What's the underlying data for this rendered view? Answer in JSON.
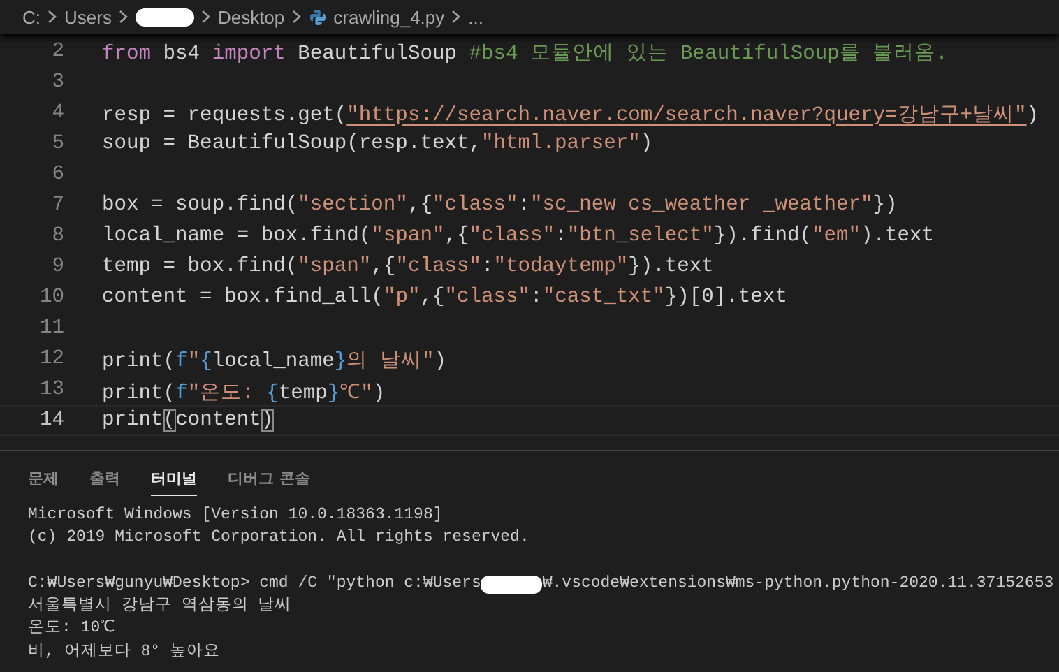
{
  "breadcrumb": [
    {
      "kind": "text",
      "text": "C:"
    },
    {
      "kind": "text",
      "text": "Users"
    },
    {
      "kind": "redacted"
    },
    {
      "kind": "text",
      "text": "Desktop"
    },
    {
      "kind": "file",
      "text": "crawling_4.py"
    },
    {
      "kind": "text",
      "text": "..."
    }
  ],
  "editor": {
    "lines": [
      {
        "number": "2",
        "current": false,
        "tokens": [
          {
            "kind": "keyword",
            "text": "from"
          },
          {
            "kind": "plain",
            "text": " bs4 "
          },
          {
            "kind": "keyword",
            "text": "import"
          },
          {
            "kind": "plain",
            "text": " BeautifulSoup "
          },
          {
            "kind": "comment",
            "text": "#bs4 모듈안에 있는 BeautifulSoup를 불러옴."
          }
        ]
      },
      {
        "number": "3",
        "current": false
      },
      {
        "number": "4",
        "current": false,
        "tokens": [
          {
            "kind": "plain",
            "text": "resp = requests.get("
          },
          {
            "kind": "link",
            "text": "\"https://search.naver.com/search.naver?query=강남구+날씨\""
          },
          {
            "kind": "plain",
            "text": ")"
          }
        ]
      },
      {
        "number": "5",
        "current": false,
        "tokens": [
          {
            "kind": "plain",
            "text": "soup = BeautifulSoup(resp.text,"
          },
          {
            "kind": "string",
            "text": "\"html.parser\""
          },
          {
            "kind": "plain",
            "text": ")"
          }
        ]
      },
      {
        "number": "6",
        "current": false
      },
      {
        "number": "7",
        "current": false,
        "tokens": [
          {
            "kind": "plain",
            "text": "box = soup.find("
          },
          {
            "kind": "string",
            "text": "\"section\""
          },
          {
            "kind": "plain",
            "text": ",{"
          },
          {
            "kind": "string",
            "text": "\"class\""
          },
          {
            "kind": "plain",
            "text": ":"
          },
          {
            "kind": "string",
            "text": "\"sc_new cs_weather _weather\""
          },
          {
            "kind": "plain",
            "text": "})"
          }
        ]
      },
      {
        "number": "8",
        "current": false,
        "tokens": [
          {
            "kind": "plain",
            "text": "local_name = box.find("
          },
          {
            "kind": "string",
            "text": "\"span\""
          },
          {
            "kind": "plain",
            "text": ",{"
          },
          {
            "kind": "string",
            "text": "\"class\""
          },
          {
            "kind": "plain",
            "text": ":"
          },
          {
            "kind": "string",
            "text": "\"btn_select\""
          },
          {
            "kind": "plain",
            "text": "}).find("
          },
          {
            "kind": "string",
            "text": "\"em\""
          },
          {
            "kind": "plain",
            "text": ").text"
          }
        ]
      },
      {
        "number": "9",
        "current": false,
        "tokens": [
          {
            "kind": "plain",
            "text": "temp = box.find("
          },
          {
            "kind": "string",
            "text": "\"span\""
          },
          {
            "kind": "plain",
            "text": ",{"
          },
          {
            "kind": "string",
            "text": "\"class\""
          },
          {
            "kind": "plain",
            "text": ":"
          },
          {
            "kind": "string",
            "text": "\"todaytemp\""
          },
          {
            "kind": "plain",
            "text": "}).text"
          }
        ]
      },
      {
        "number": "10",
        "current": false,
        "tokens": [
          {
            "kind": "plain",
            "text": "content = box.find_all("
          },
          {
            "kind": "string",
            "text": "\"p\""
          },
          {
            "kind": "plain",
            "text": ",{"
          },
          {
            "kind": "string",
            "text": "\"class\""
          },
          {
            "kind": "plain",
            "text": ":"
          },
          {
            "kind": "string",
            "text": "\"cast_txt\""
          },
          {
            "kind": "plain",
            "text": "})[0].text"
          }
        ]
      },
      {
        "number": "11",
        "current": false
      },
      {
        "number": "12",
        "current": false,
        "tokens": [
          {
            "kind": "plain",
            "text": "print("
          },
          {
            "kind": "fprefix",
            "text": "f"
          },
          {
            "kind": "string",
            "text": "\""
          },
          {
            "kind": "brace",
            "text": "{"
          },
          {
            "kind": "plain",
            "text": "local_name"
          },
          {
            "kind": "brace",
            "text": "}"
          },
          {
            "kind": "string",
            "text": "의 날씨\""
          },
          {
            "kind": "plain",
            "text": ")"
          }
        ]
      },
      {
        "number": "13",
        "current": false,
        "tokens": [
          {
            "kind": "plain",
            "text": "print("
          },
          {
            "kind": "fprefix",
            "text": "f"
          },
          {
            "kind": "string",
            "text": "\"온도: "
          },
          {
            "kind": "brace",
            "text": "{"
          },
          {
            "kind": "plain",
            "text": "temp"
          },
          {
            "kind": "brace",
            "text": "}"
          },
          {
            "kind": "string",
            "text": "℃\""
          },
          {
            "kind": "plain",
            "text": ")"
          }
        ]
      },
      {
        "number": "14",
        "current": true,
        "tokens": [
          {
            "kind": "plain",
            "text": "print"
          },
          {
            "kind": "bracket_match",
            "text": "("
          },
          {
            "kind": "plain",
            "text": "content"
          },
          {
            "kind": "bracket_match",
            "text": ")"
          }
        ]
      }
    ]
  },
  "panel": {
    "tabs": [
      {
        "label": "문제",
        "selected": false
      },
      {
        "label": "출력",
        "selected": false
      },
      {
        "label": "터미널",
        "selected": true
      },
      {
        "label": "디버그 콘솔",
        "selected": false
      }
    ],
    "terminal": [
      {
        "kind": "text",
        "text": "Microsoft Windows [Version 10.0.18363.1198]"
      },
      {
        "kind": "text",
        "text": "(c) 2019 Microsoft Corporation. All rights reserved."
      },
      {
        "kind": "blank"
      },
      {
        "kind": "redacted",
        "before": "C:₩Users₩gunyu₩Desktop> cmd /C \"python c:₩Users",
        "after": "₩.vscode₩extensions₩ms-python.python-2020.11.37152653"
      },
      {
        "kind": "text",
        "text": "서울특별시 강남구 역삼동의 날씨"
      },
      {
        "kind": "text",
        "text": "온도: 10℃"
      },
      {
        "kind": "text",
        "text": "비, 어제보다 8° 높아요"
      }
    ]
  }
}
